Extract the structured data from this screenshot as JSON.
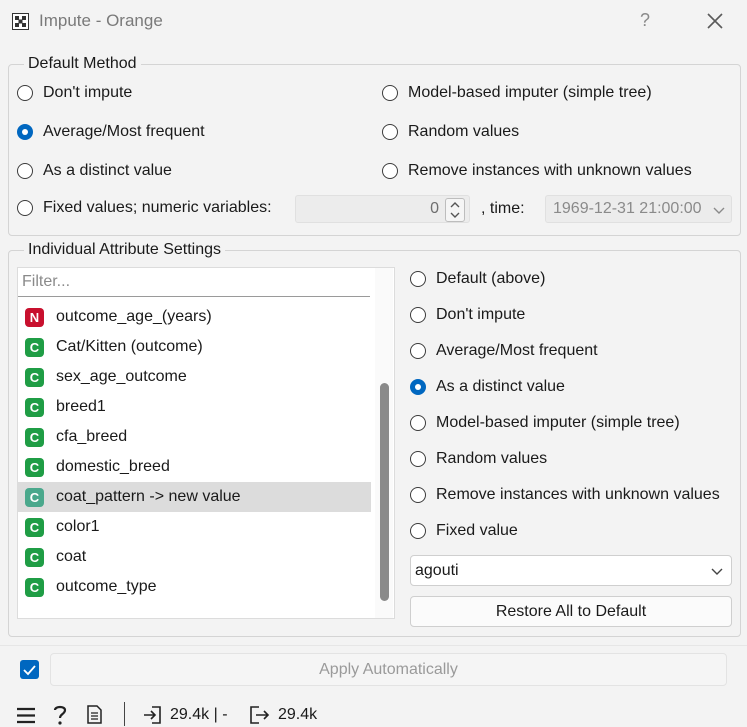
{
  "window": {
    "title": "Impute - Orange",
    "help": "?"
  },
  "default_method": {
    "title": "Default Method",
    "options": [
      {
        "label": "Don't impute",
        "checked": false
      },
      {
        "label": "Average/Most frequent",
        "checked": true
      },
      {
        "label": "As a distinct value",
        "checked": false
      },
      {
        "label": "Fixed values; numeric variables:",
        "checked": false
      },
      {
        "label": "Model-based imputer (simple tree)",
        "checked": false
      },
      {
        "label": "Random values",
        "checked": false
      },
      {
        "label": "Remove instances with unknown values",
        "checked": false
      }
    ],
    "numeric_value": "0",
    "time_label": ", time:",
    "time_value": "1969-12-31 21:00:00"
  },
  "individual": {
    "title": "Individual Attribute Settings",
    "filter_placeholder": "Filter...",
    "attributes": [
      {
        "type": "N",
        "name": "outcome_age_(years)"
      },
      {
        "type": "C",
        "name": "Cat/Kitten (outcome)"
      },
      {
        "type": "C",
        "name": "sex_age_outcome"
      },
      {
        "type": "C",
        "name": "breed1"
      },
      {
        "type": "C",
        "name": "cfa_breed"
      },
      {
        "type": "C",
        "name": "domestic_breed"
      },
      {
        "type": "C",
        "name": "coat_pattern -> new value",
        "selected": true
      },
      {
        "type": "C",
        "name": "color1"
      },
      {
        "type": "C",
        "name": "coat"
      },
      {
        "type": "C",
        "name": "outcome_type"
      }
    ],
    "methods": [
      {
        "label": "Default (above)",
        "checked": false
      },
      {
        "label": "Don't impute",
        "checked": false
      },
      {
        "label": "Average/Most frequent",
        "checked": false
      },
      {
        "label": "As a distinct value",
        "checked": true
      },
      {
        "label": "Model-based imputer (simple tree)",
        "checked": false
      },
      {
        "label": "Random values",
        "checked": false
      },
      {
        "label": "Remove instances with unknown values",
        "checked": false
      },
      {
        "label": "Fixed value",
        "checked": false
      }
    ],
    "fixed_value": "agouti",
    "restore_label": "Restore All to Default"
  },
  "bottom": {
    "auto_apply_checked": true,
    "apply_label": "Apply Automatically"
  },
  "status": {
    "input_count": "29.4k |  -",
    "output_count": "29.4k"
  },
  "colors": {
    "accent": "#0067c0",
    "numeric_badge": "#c8102e",
    "categorical_badge": "#1f9d45"
  }
}
